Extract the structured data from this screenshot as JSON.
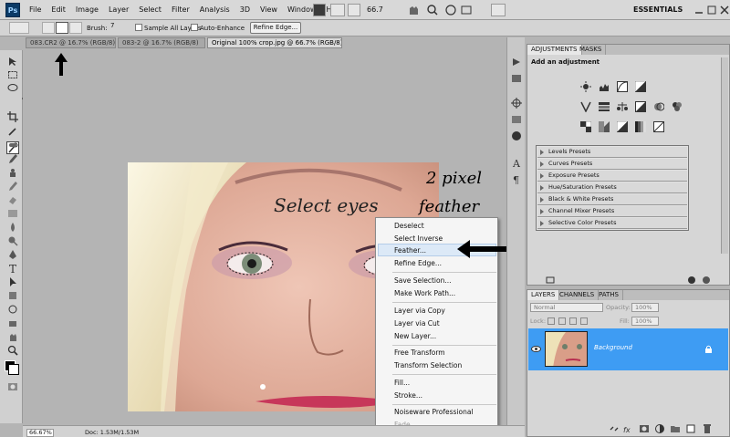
{
  "app": {
    "logo": "Ps",
    "workspace": "ESSENTIALS"
  },
  "menu": [
    "File",
    "Edit",
    "Image",
    "Layer",
    "Select",
    "Filter",
    "Analysis",
    "3D",
    "View",
    "Window",
    "Help"
  ],
  "menubar": {
    "zoom": "66.7"
  },
  "options": {
    "brush_label": "Brush:",
    "brush_size": "7",
    "sample_all_layers": "Sample All Layers",
    "auto_enhance": "Auto-Enhance",
    "refine_edge": "Refine Edge..."
  },
  "tabs": [
    {
      "label": "083.CR2 @ 16.7% (RGB/8)",
      "active": false
    },
    {
      "label": "083-2 @ 16.7% (RGB/8)",
      "active": false
    },
    {
      "label": "Original 100% crop.jpg @ 66.7% (RGB/8) *",
      "active": true
    }
  ],
  "canvas": {
    "text_select_eyes": "Select eyes",
    "text_two_pixel": "2 pixel",
    "text_feather": "feather"
  },
  "context_menu": {
    "items": [
      "Deselect",
      "Select Inverse",
      "Feather...",
      "Refine Edge...",
      "Save Selection...",
      "Make Work Path...",
      "Layer via Copy",
      "Layer via Cut",
      "New Layer...",
      "Free Transform",
      "Transform Selection",
      "Fill...",
      "Stroke...",
      "Noiseware Professional",
      "Fade..."
    ],
    "highlighted": "Feather...",
    "disabled": "Fade..."
  },
  "status": {
    "zoom": "66.67%",
    "doc": "Doc: 1.53M/1.53M"
  },
  "adjustments": {
    "tabs": [
      "ADJUSTMENTS",
      "MASKS"
    ],
    "heading": "Add an adjustment",
    "presets": [
      "Levels Presets",
      "Curves Presets",
      "Exposure Presets",
      "Hue/Saturation Presets",
      "Black & White Presets",
      "Channel Mixer Presets",
      "Selective Color Presets"
    ]
  },
  "layers": {
    "tabs": [
      "LAYERS",
      "CHANNELS",
      "PATHS"
    ],
    "blend_mode": "Normal",
    "opacity_label": "Opacity:",
    "opacity": "100%",
    "lock_label": "Lock:",
    "fill_label": "Fill:",
    "fill": "100%",
    "layer_name": "Background"
  },
  "colors": {
    "accent": "#3e9cf3",
    "selection_highlight": "#dce9f7"
  }
}
